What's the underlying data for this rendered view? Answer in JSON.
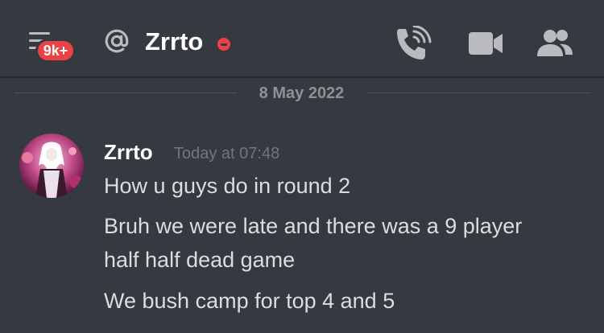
{
  "header": {
    "unread_badge": "9k+",
    "at_symbol": "@",
    "dm_name": "Zrrto",
    "status": "do-not-disturb",
    "icons": [
      "hamburger-menu-icon",
      "at-icon",
      "phone-call-icon",
      "video-camera-icon",
      "members-icon"
    ]
  },
  "divider": {
    "date": "8 May 2022"
  },
  "message": {
    "author": "Zrrto",
    "timestamp": "Today at 07:48",
    "lines": [
      "How u guys do in round 2",
      "Bruh we were late and there was a 9 player",
      "half half dead game",
      "We bush camp for top 4 and 5"
    ]
  },
  "colors": {
    "background": "#36393f",
    "badge": "#ed4245",
    "dnd": "#ed4245",
    "text": "#dcddde",
    "muted": "#72767d"
  }
}
